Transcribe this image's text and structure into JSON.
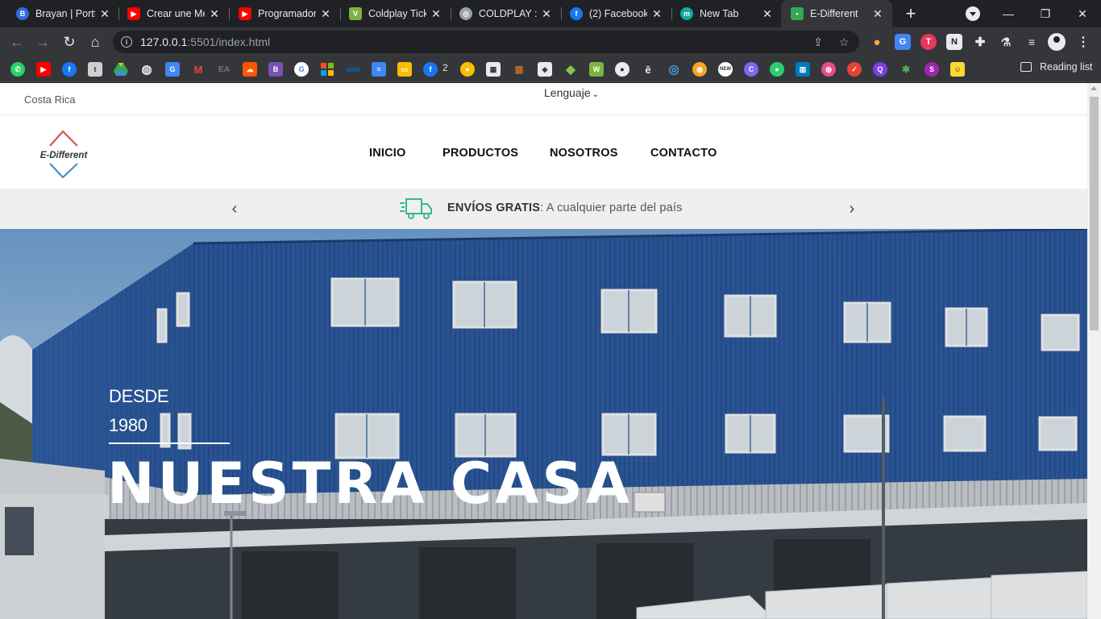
{
  "browser": {
    "tabs": [
      {
        "title": "Brayan | Portfo",
        "favicon": "bootstrap-icon",
        "color": "#2d6cdf"
      },
      {
        "title": "Crear une Me",
        "favicon": "youtube-icon",
        "color": "#ff0000"
      },
      {
        "title": "Programador",
        "favicon": "youtube-icon",
        "color": "#ff0000"
      },
      {
        "title": "Coldplay Tick",
        "favicon": "tickets-icon",
        "color": "#7cb342"
      },
      {
        "title": "COLDPLAY : E",
        "favicon": "globe-icon",
        "color": "#9aa0a6"
      },
      {
        "title": "(2) Facebook",
        "favicon": "facebook-icon",
        "color": "#1877f2"
      },
      {
        "title": "New Tab",
        "favicon": "m-icon",
        "color": "#16a7a0"
      },
      {
        "title": "E-Different",
        "favicon": "site-icon",
        "color": "#34a853",
        "active": true
      }
    ],
    "new_tab_label": "+",
    "url_host": "127.0.0.1",
    "url_rest": ":5501/index.html",
    "bookmarks_count_label": "2",
    "reading_list_label": "Reading list"
  },
  "site": {
    "country": "Costa Rica",
    "language": "Lenguaje",
    "logo_text": "E-Different",
    "menu": [
      "INICIO",
      "PRODUCTOS",
      "NOSOTROS",
      "CONTACTO"
    ],
    "promo_bold": "ENVÍOS GRATIS",
    "promo_rest": ": A cualquier parte del país",
    "hero_line1": "DESDE",
    "hero_line2": "1980",
    "hero_title": "NUESTRA CASA"
  },
  "colors": {
    "accent_red": "#d9534f",
    "accent_blue": "#4a90c2",
    "truck_green": "#3bb88f",
    "building_blue": "#2f5ea6"
  }
}
